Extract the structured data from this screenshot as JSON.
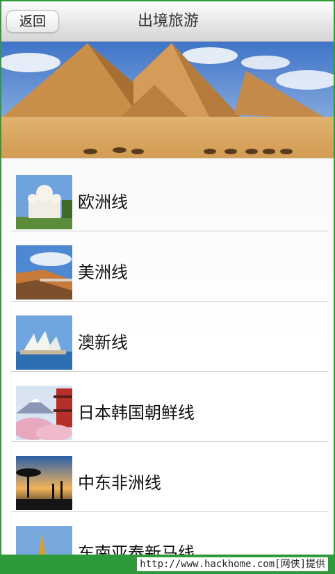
{
  "nav": {
    "back_label": "返回",
    "title": "出境旅游"
  },
  "banner": {
    "image": "pyramids-desert-camels"
  },
  "routes": [
    {
      "label": "欧洲线",
      "thumb": "cathedral-white-domes"
    },
    {
      "label": "美洲线",
      "thumb": "coastal-highway-cliffs"
    },
    {
      "label": "澳新线",
      "thumb": "sydney-opera-house"
    },
    {
      "label": "日本韩国朝鲜线",
      "thumb": "mount-fuji-pagoda-blossoms"
    },
    {
      "label": "中东非洲线",
      "thumb": "savanna-giraffes-sunset"
    },
    {
      "label": "东南亚泰新马线",
      "thumb": "golden-temple-stupa"
    }
  ],
  "footer": {
    "watermark": "http://www.hackhome.com[网侠]提供"
  },
  "colors": {
    "frame_green": "#2f9a3a",
    "nav_text": "#333333"
  }
}
